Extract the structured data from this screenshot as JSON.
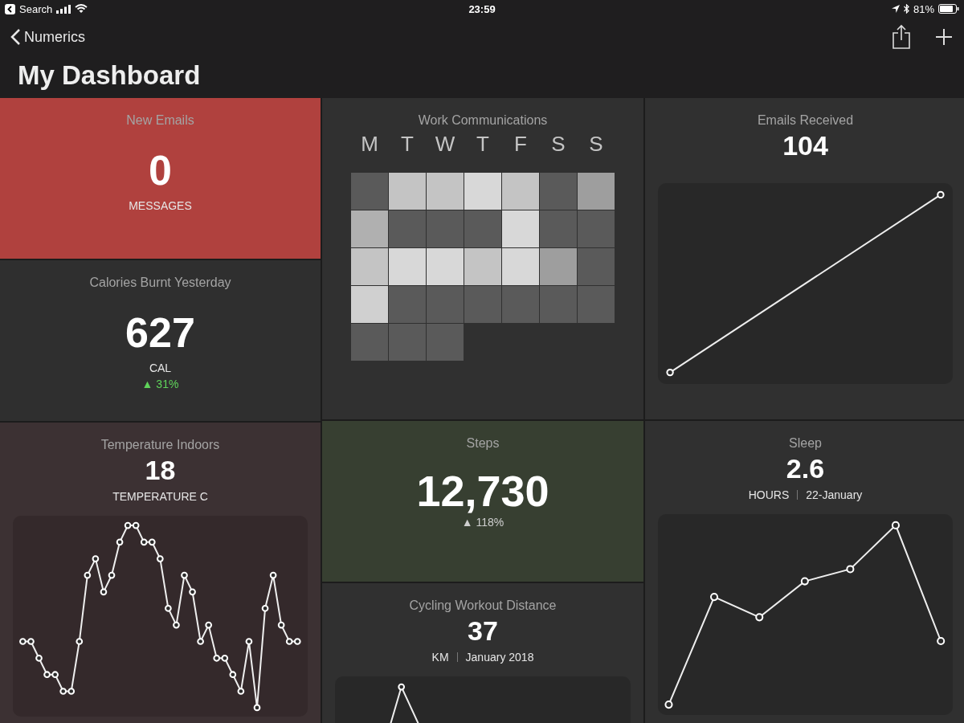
{
  "status_bar": {
    "back_app": "Search",
    "time": "23:59",
    "battery": "81%"
  },
  "nav": {
    "back": "Numerics",
    "title": "My Dashboard"
  },
  "columns": [
    [
      {
        "kind": "number",
        "title": "New Emails",
        "value": "0",
        "unit": "MESSAGES",
        "color": "#b0413e"
      },
      {
        "kind": "number",
        "title": "Calories Burnt Yesterday",
        "value": "627",
        "unit": "CAL",
        "change": {
          "text": "▲ 31%",
          "highlighted": true
        },
        "color": "#2f2f2f"
      },
      {
        "kind": "line",
        "title": "Temperature Indoors",
        "value": "18",
        "unit": "TEMPERATURE C",
        "color": "#3c3133"
      }
    ],
    [
      {
        "kind": "heatmap",
        "title": "Work Communications",
        "days": [
          "M",
          "T",
          "W",
          "T",
          "F",
          "S",
          "S"
        ],
        "color": "#303030",
        "cells": [
          {
            "color": "#5a5a5a"
          },
          {
            "color": "#c4c4c4"
          },
          {
            "color": "#c4c4c4"
          },
          {
            "color": "#d8d8d8"
          },
          {
            "color": "#c4c4c4"
          },
          {
            "color": "#5a5a5a"
          },
          {
            "color": "#9e9e9e"
          },
          {
            "color": "#b0b0b0"
          },
          {
            "color": "#5a5a5a"
          },
          {
            "color": "#5a5a5a"
          },
          {
            "color": "#5a5a5a"
          },
          {
            "color": "#d8d8d8"
          },
          {
            "color": "#5a5a5a"
          },
          {
            "color": "#5a5a5a"
          },
          {
            "color": "#c4c4c4"
          },
          {
            "color": "#d8d8d8"
          },
          {
            "color": "#d8d8d8"
          },
          {
            "color": "#c4c4c4"
          },
          {
            "color": "#d8d8d8"
          },
          {
            "color": "#9e9e9e"
          },
          {
            "color": "#5a5a5a"
          },
          {
            "color": "#d0d0d0"
          },
          {
            "color": "#5a5a5a"
          },
          {
            "color": "#5a5a5a"
          },
          {
            "color": "#5a5a5a"
          },
          {
            "color": "#5a5a5a"
          },
          {
            "color": "#5a5a5a"
          },
          {
            "color": "#5a5a5a"
          },
          {
            "color": "#5a5a5a"
          },
          {
            "color": "#5a5a5a"
          },
          {
            "color": "#5a5a5a"
          }
        ]
      },
      {
        "kind": "number",
        "title": "Steps",
        "value": "12,730",
        "change": {
          "text": "▲ 118%",
          "highlighted": false
        },
        "color": "#373f31"
      },
      {
        "kind": "line",
        "title": "Cycling Workout Distance",
        "value": "37",
        "unit": "KM",
        "period": "January 2018",
        "color": "#303030"
      }
    ],
    [
      {
        "kind": "line",
        "title": "Emails Received",
        "value": "104",
        "color": "#303030"
      },
      {
        "kind": "line",
        "title": "Sleep",
        "value": "2.6",
        "unit": "HOURS",
        "period": "22-January",
        "color": "#303030"
      }
    ]
  ]
}
